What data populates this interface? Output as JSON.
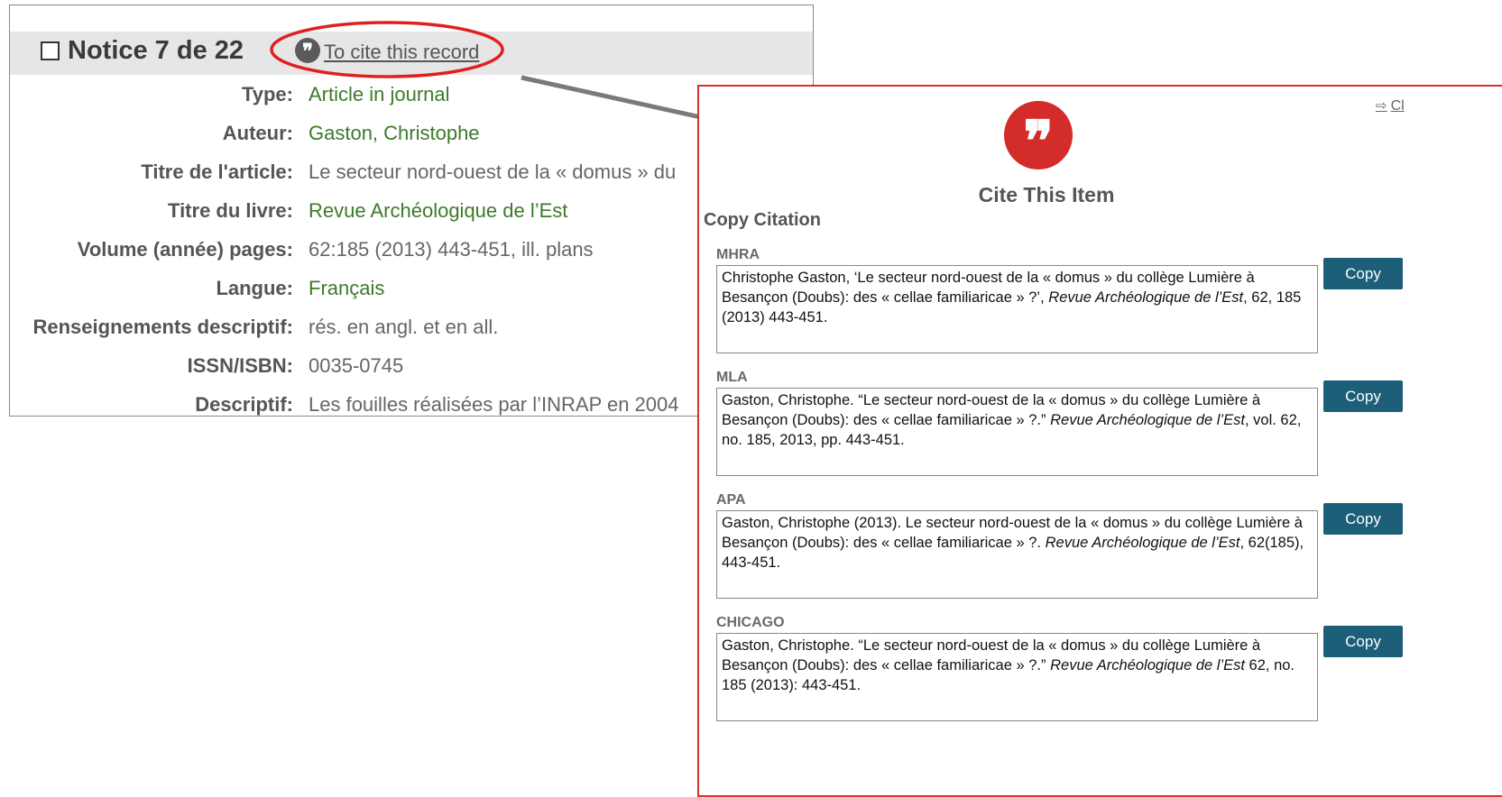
{
  "record": {
    "title": "Notice 7 de 22",
    "cite_link": "To cite this record",
    "fields": [
      {
        "label": "Type:",
        "value": "Article in journal",
        "color": "green"
      },
      {
        "label": "Auteur:",
        "value": "Gaston, Christophe",
        "color": "green"
      },
      {
        "label": "Titre de l'article:",
        "value": "Le secteur nord-ouest de la « domus » du",
        "color": "gray"
      },
      {
        "label": "Titre du livre:",
        "value": "Revue Archéologique de l’Est",
        "color": "green"
      },
      {
        "label": "Volume (année) pages:",
        "value": "62:185 (2013) 443-451, ill. plans",
        "color": "gray"
      },
      {
        "label": "Langue:",
        "value": "Français",
        "color": "green"
      },
      {
        "label": "Renseignements descriptif:",
        "value": "rés. en angl. et en all.",
        "color": "gray"
      },
      {
        "label": "ISSN/ISBN:",
        "value": "0035-0745",
        "color": "gray"
      },
      {
        "label": "Descriptif:",
        "value": "Les fouilles réalisées par l’INRAP en 2004",
        "color": "gray"
      }
    ]
  },
  "dialog": {
    "close_label": "Cl",
    "title": "Cite This Item",
    "copy_heading": "Copy Citation",
    "copy_label": "Copy",
    "styles": [
      {
        "name": "MHRA",
        "pre": "Christophe Gaston, ‘Le secteur nord-ouest de la « domus » du collège Lumière à Besançon (Doubs): des « cellae familiaricae » ?’, ",
        "italic": "Revue Archéologique de l’Est",
        "post": ", 62, 185 (2013) 443-451."
      },
      {
        "name": "MLA",
        "pre": "Gaston, Christophe. “Le secteur nord-ouest de la « domus » du collège Lumière à Besançon (Doubs): des « cellae familiaricae » ?.” ",
        "italic": "Revue Archéologique de l’Est",
        "post": ", vol. 62, no. 185, 2013, pp. 443-451."
      },
      {
        "name": "APA",
        "pre": "Gaston, Christophe (2013). Le secteur nord-ouest de la « domus » du collège Lumière à Besançon (Doubs): des « cellae familiaricae » ?. ",
        "italic": "Revue Archéologique de l’Est",
        "post": ", 62(185), 443-451."
      },
      {
        "name": "CHICAGO",
        "pre": "Gaston, Christophe. “Le secteur nord-ouest de la « domus » du collège Lumière à Besançon (Doubs): des « cellae familiaricae » ?.” ",
        "italic": "Revue Archéologique de l’Est",
        "post": " 62, no. 185 (2013): 443-451."
      }
    ]
  },
  "colors": {
    "accent_red": "#d42b2b",
    "button_blue": "#1d5e79",
    "link_green": "#3d7a2b"
  },
  "icons": {
    "cite": "quote-icon",
    "close": "document-arrow-icon"
  }
}
